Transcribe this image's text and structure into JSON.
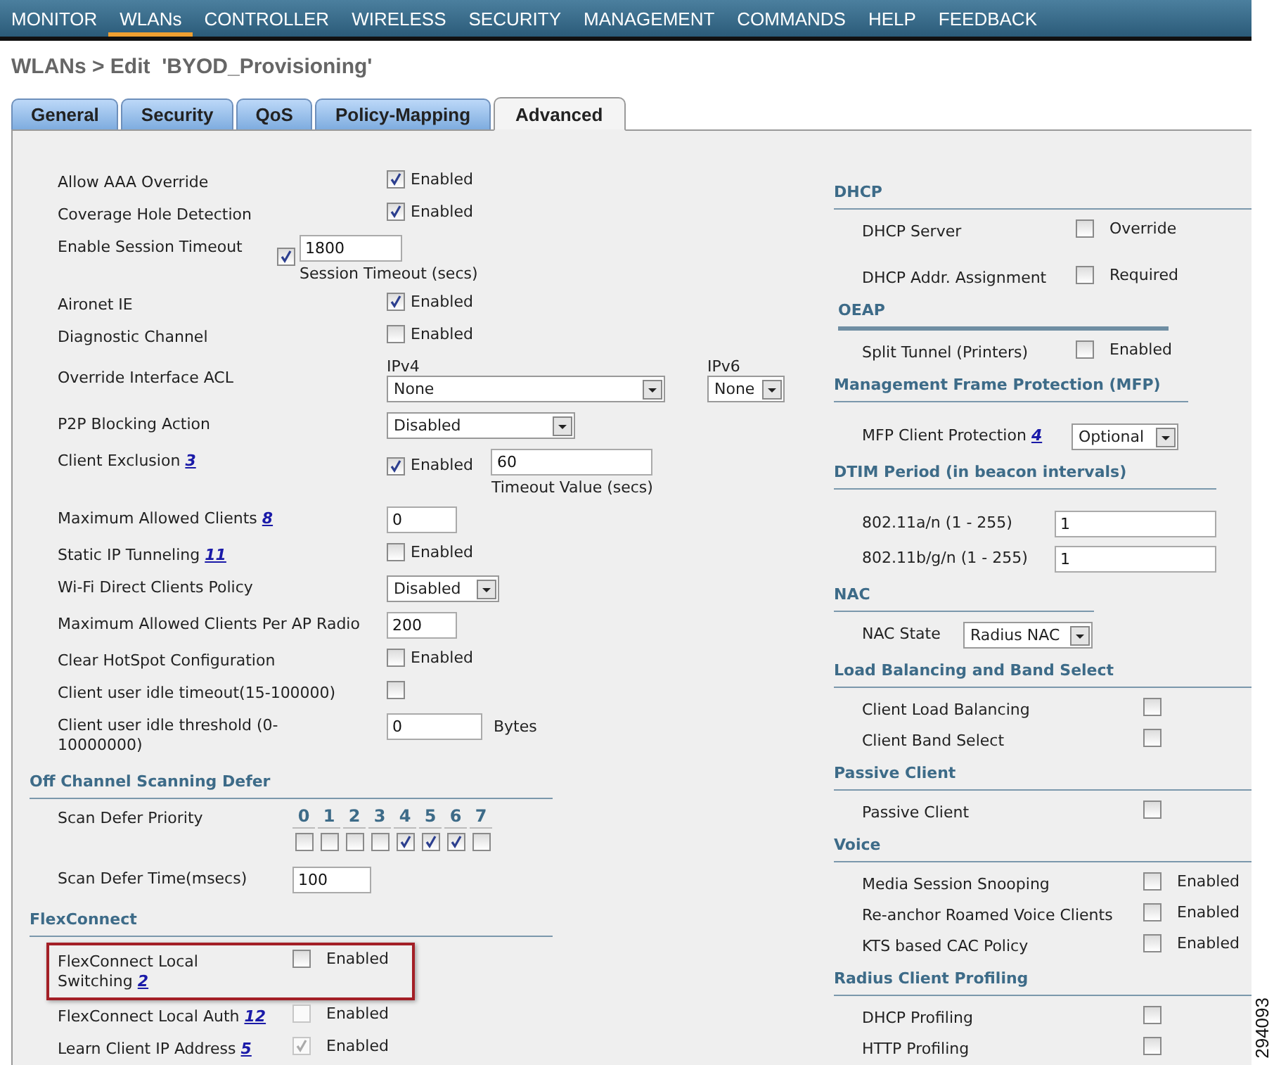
{
  "nav": [
    {
      "label": "MONITOR",
      "selected": false
    },
    {
      "label": "WLANs",
      "selected": true
    },
    {
      "label": "CONTROLLER",
      "selected": false
    },
    {
      "label": "WIRELESS",
      "selected": false
    },
    {
      "label": "SECURITY",
      "selected": false
    },
    {
      "label": "MANAGEMENT",
      "selected": false
    },
    {
      "label": "COMMANDS",
      "selected": false
    },
    {
      "label": "HELP",
      "selected": false
    },
    {
      "label": "FEEDBACK",
      "selected": false
    }
  ],
  "page_title": "WLANs > Edit  'BYOD_Provisioning'",
  "tabs": [
    {
      "label": "General",
      "selected": false
    },
    {
      "label": "Security",
      "selected": false
    },
    {
      "label": "QoS",
      "selected": false
    },
    {
      "label": "Policy-Mapping",
      "selected": false
    },
    {
      "label": "Advanced",
      "selected": true
    }
  ],
  "left_settings": [
    {
      "kind": "checkbox",
      "label": "Allow AAA Override",
      "checked": true,
      "option": "Enabled"
    },
    {
      "kind": "checkbox",
      "label": "Coverage Hole Detection",
      "checked": true,
      "option": "Enabled"
    },
    {
      "kind": "checkbox_field",
      "label": "Enable Session Timeout",
      "checked": true,
      "value": "1800",
      "caption": "Session Timeout (secs)"
    },
    {
      "kind": "checkbox",
      "label": "Aironet IE",
      "checked": true,
      "option": "Enabled"
    },
    {
      "kind": "checkbox",
      "label": "Diagnostic Channel",
      "checked": false,
      "option": "Enabled"
    },
    {
      "kind": "acl",
      "label": "Override Interface ACL",
      "ipv4_label": "IPv4",
      "ipv4_value": "None",
      "ipv6_label": "IPv6",
      "ipv6_value": "None"
    },
    {
      "kind": "select",
      "label": "P2P Blocking Action",
      "value": "Disabled"
    },
    {
      "kind": "checkbox_field",
      "label": "Client Exclusion",
      "note": "3",
      "checked": true,
      "option": "Enabled",
      "value": "60",
      "caption": "Timeout Value (secs)"
    },
    {
      "kind": "field",
      "label": "Maximum Allowed Clients",
      "note": "8",
      "value": "0"
    },
    {
      "kind": "checkbox",
      "label": "Static IP Tunneling",
      "note": "11",
      "checked": false,
      "option": "Enabled"
    },
    {
      "kind": "select",
      "label": "Wi-Fi Direct Clients Policy",
      "value": "Disabled"
    },
    {
      "kind": "field",
      "label": "Maximum Allowed Clients Per AP Radio",
      "value": "200"
    },
    {
      "kind": "checkbox",
      "label": "Clear HotSpot Configuration",
      "checked": false,
      "option": "Enabled"
    },
    {
      "kind": "checkbox",
      "label": "Client user idle timeout(15-100000)",
      "checked": false
    },
    {
      "kind": "field",
      "label": "Client user idle threshold (0-10000000)",
      "value": "0",
      "unit": "Bytes"
    }
  ],
  "left_sections": [
    {
      "title": "Off Channel Scanning Defer",
      "items": [
        {
          "kind": "priority",
          "label": "Scan Defer Priority",
          "levels": [
            {
              "label": "0",
              "checked": false
            },
            {
              "label": "1",
              "checked": false
            },
            {
              "label": "2",
              "checked": false
            },
            {
              "label": "3",
              "checked": false
            },
            {
              "label": "4",
              "checked": true
            },
            {
              "label": "5",
              "checked": true
            },
            {
              "label": "6",
              "checked": true
            },
            {
              "label": "7",
              "checked": false
            }
          ]
        },
        {
          "kind": "field",
          "label": "Scan Defer Time(msecs)",
          "value": "100"
        }
      ]
    },
    {
      "title": "FlexConnect",
      "items": [
        {
          "kind": "checkbox",
          "label": "FlexConnect Local Switching",
          "note": "2",
          "checked": false,
          "disabled": false,
          "highlighted": true,
          "option": "Enabled"
        },
        {
          "kind": "checkbox",
          "label": "FlexConnect Local Auth",
          "note": "12",
          "checked": false,
          "disabled": true,
          "highlighted": false,
          "option": "Enabled"
        },
        {
          "kind": "checkbox",
          "label": "Learn Client IP Address",
          "note": "5",
          "checked": true,
          "disabled": true,
          "highlighted": false,
          "option": "Enabled"
        }
      ]
    }
  ],
  "right_sections": [
    {
      "title": "DHCP",
      "items": [
        {
          "kind": "checkbox",
          "label": "DHCP Server",
          "checked": false,
          "option": "Override"
        },
        {
          "kind": "checkbox",
          "label": "DHCP Addr. Assignment",
          "checked": false,
          "option": "Required"
        }
      ]
    },
    {
      "title": "OEAP",
      "items": [
        {
          "kind": "checkbox",
          "label": "Split Tunnel (Printers)",
          "checked": false,
          "option": "Enabled"
        }
      ]
    },
    {
      "title": "Management Frame Protection (MFP)",
      "items": [
        {
          "kind": "select",
          "label": "MFP Client Protection",
          "note": "4",
          "value": "Optional"
        }
      ]
    },
    {
      "title": "DTIM Period (in beacon intervals)",
      "items": [
        {
          "kind": "field",
          "label": "802.11a/n (1 - 255)",
          "value": "1"
        },
        {
          "kind": "field",
          "label": "802.11b/g/n (1 - 255)",
          "value": "1"
        }
      ]
    },
    {
      "title": "NAC",
      "items": [
        {
          "kind": "select",
          "label": "NAC State",
          "value": "Radius NAC"
        }
      ]
    },
    {
      "title": "Load Balancing and Band Select",
      "items": [
        {
          "kind": "checkbox",
          "label": "Client Load Balancing",
          "checked": false
        },
        {
          "kind": "checkbox",
          "label": "Client Band Select",
          "checked": false
        }
      ]
    },
    {
      "title": "Passive Client",
      "items": [
        {
          "kind": "checkbox",
          "label": "Passive Client",
          "checked": false
        }
      ]
    },
    {
      "title": "Voice",
      "items": [
        {
          "kind": "checkbox",
          "label": "Media Session Snooping",
          "checked": false,
          "option": "Enabled"
        },
        {
          "kind": "checkbox",
          "label": "Re-anchor Roamed Voice Clients",
          "checked": false,
          "option": "Enabled"
        },
        {
          "kind": "checkbox",
          "label": "KTS based CAC Policy",
          "checked": false,
          "option": "Enabled"
        }
      ]
    },
    {
      "title": "Radius Client Profiling",
      "items": [
        {
          "kind": "checkbox",
          "label": "DHCP Profiling",
          "checked": false
        },
        {
          "kind": "checkbox",
          "label": "HTTP Profiling",
          "checked": false
        }
      ]
    }
  ],
  "figure_number": "294093"
}
